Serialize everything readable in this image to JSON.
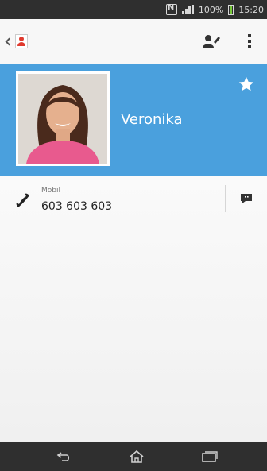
{
  "status_bar": {
    "battery": "100%",
    "time": "15:20",
    "icons": [
      "nfc-icon",
      "signal-icon",
      "battery-icon"
    ]
  },
  "action_bar": {
    "icons": [
      "back-icon",
      "contacts-app-icon",
      "edit-contact-icon",
      "overflow-menu-icon"
    ]
  },
  "contact": {
    "name": "Veronika",
    "favorite": true,
    "phones": [
      {
        "type": "Mobil",
        "number": "603 603 603"
      }
    ]
  },
  "nav_bar": {
    "icons": [
      "back-icon",
      "home-icon",
      "recents-icon"
    ]
  },
  "colors": {
    "header": "#4aa0dd",
    "status_bar": "#2f2f2f",
    "battery_fill": "#7acb3c"
  }
}
